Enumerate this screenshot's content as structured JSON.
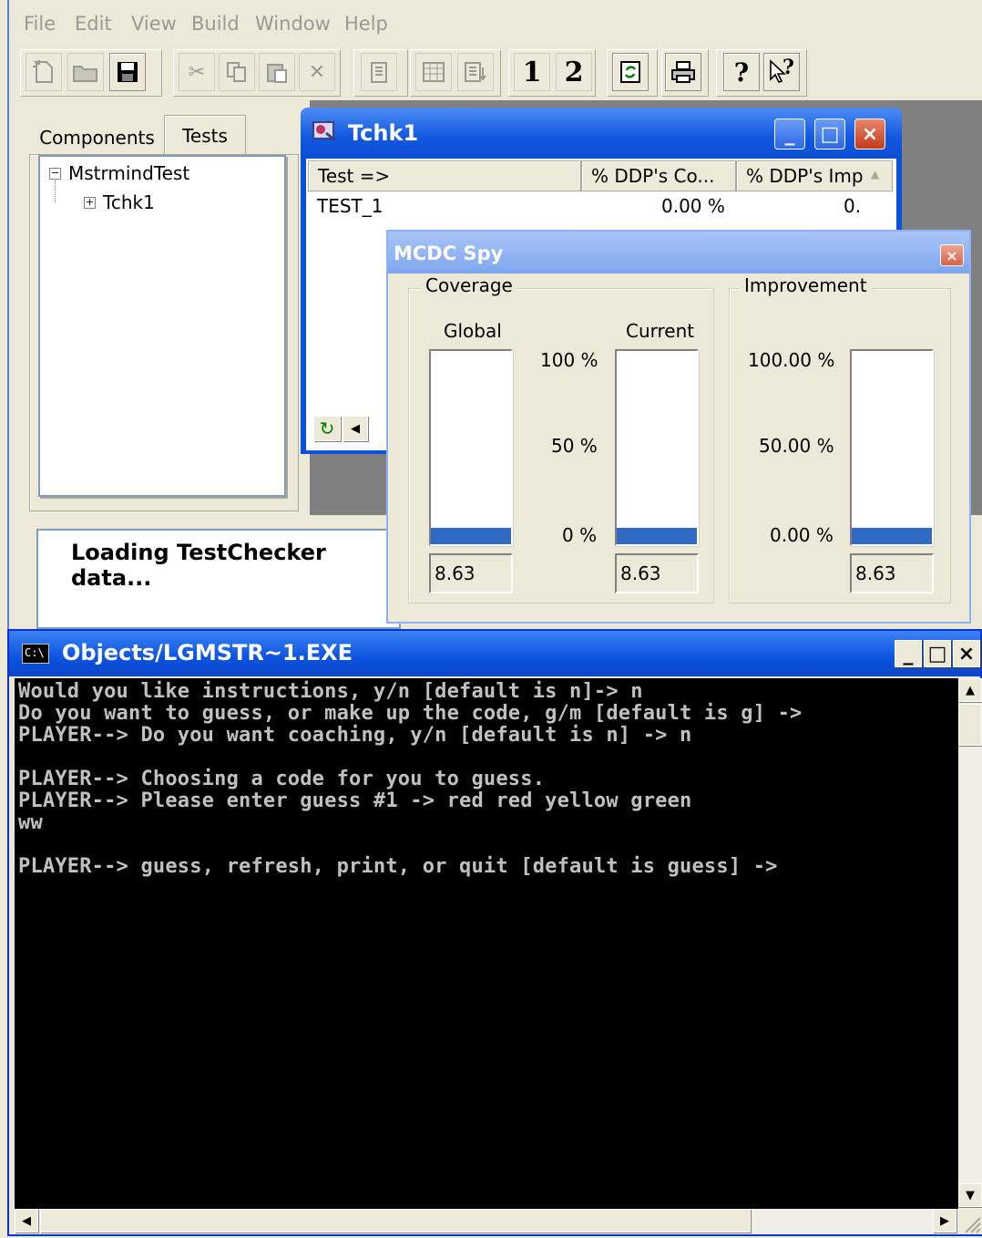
{
  "menu": [
    "File",
    "Edit",
    "View",
    "Build",
    "Window",
    "Help"
  ],
  "toolbar": {
    "btn_1": "1",
    "btn_2": "2",
    "help_glyph": "?",
    "whats_this_glyph": "?"
  },
  "left_panel": {
    "tabs": [
      "Components",
      "Tests"
    ],
    "tree": {
      "root": "MstrmindTest",
      "child": "Tchk1",
      "root_toggle": "−",
      "child_toggle": "+"
    }
  },
  "status": {
    "text": "Loading TestChecker data..."
  },
  "tchk1": {
    "title": "Tchk1",
    "columns": [
      "Test =>",
      "% DDP's Co...",
      "% DDP's Imp"
    ],
    "rows": [
      {
        "test": "TEST_1",
        "coverage": "0.00 %",
        "improvement": "0."
      }
    ],
    "buttons": {
      "minimize": "_",
      "maximize": "□",
      "close": "×"
    }
  },
  "spy": {
    "title": "MCDC Spy",
    "close": "×",
    "coverage": {
      "label": "Coverage",
      "global_label": "Global",
      "current_label": "Current",
      "scale": [
        "100 %",
        "50 %",
        "0 %"
      ],
      "global_value": "8.63",
      "current_value": "8.63",
      "global_fraction": 0.0863,
      "current_fraction": 0.0863
    },
    "improvement": {
      "label": "Improvement",
      "scale": [
        "100.00 %",
        "50.00 %",
        "0.00 %"
      ],
      "value": "8.63",
      "fraction": 0.0863
    }
  },
  "console": {
    "title": "Objects/LGMSTR~1.EXE",
    "icon_text": "C:\\",
    "buttons": {
      "minimize": "_",
      "maximize": "□",
      "close": "×"
    },
    "lines": [
      "Would you like instructions, y/n [default is n]-> n",
      "Do you want to guess, or make up the code, g/m [default is g] ->",
      "PLAYER--> Do you want coaching, y/n [default is n] -> n",
      "",
      "PLAYER--> Choosing a code for you to guess.",
      "PLAYER--> Please enter guess #1 -> red red yellow green",
      "ww",
      "",
      "PLAYER--> guess, refresh, print, or quit [default is guess] ->"
    ]
  }
}
